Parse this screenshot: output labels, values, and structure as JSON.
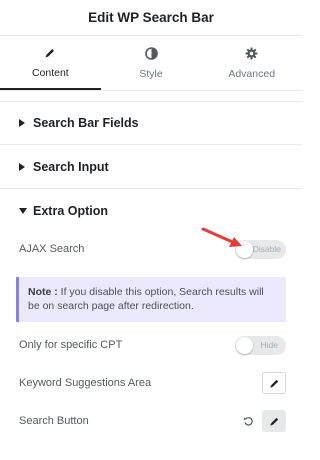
{
  "header": {
    "title": "Edit WP Search Bar"
  },
  "tabs": [
    {
      "label": "Content",
      "icon": "pencil-icon",
      "active": true
    },
    {
      "label": "Style",
      "icon": "contrast-icon",
      "active": false
    },
    {
      "label": "Advanced",
      "icon": "gear-icon",
      "active": false
    }
  ],
  "sections": {
    "search_bar_fields": {
      "title": "Search Bar Fields",
      "expanded": false
    },
    "search_input": {
      "title": "Search Input",
      "expanded": false
    },
    "extra_option": {
      "title": "Extra Option",
      "expanded": true
    }
  },
  "extra_option": {
    "ajax_search": {
      "label": "AJAX Search",
      "toggle_text": "Disable",
      "enabled": false
    },
    "note": {
      "prefix": "Note :",
      "text": " If you disable this option, Search results will be on search page after redirection."
    },
    "only_specific_cpt": {
      "label": "Only for specific CPT",
      "toggle_text": "Hide",
      "enabled": false
    },
    "keyword_suggestions": {
      "label": "Keyword Suggestions Area"
    },
    "search_button": {
      "label": "Search Button"
    }
  },
  "colors": {
    "accent_note": "#8c7fe8",
    "note_bg": "#ece8fb",
    "annotation_arrow": "#e53b3b"
  }
}
